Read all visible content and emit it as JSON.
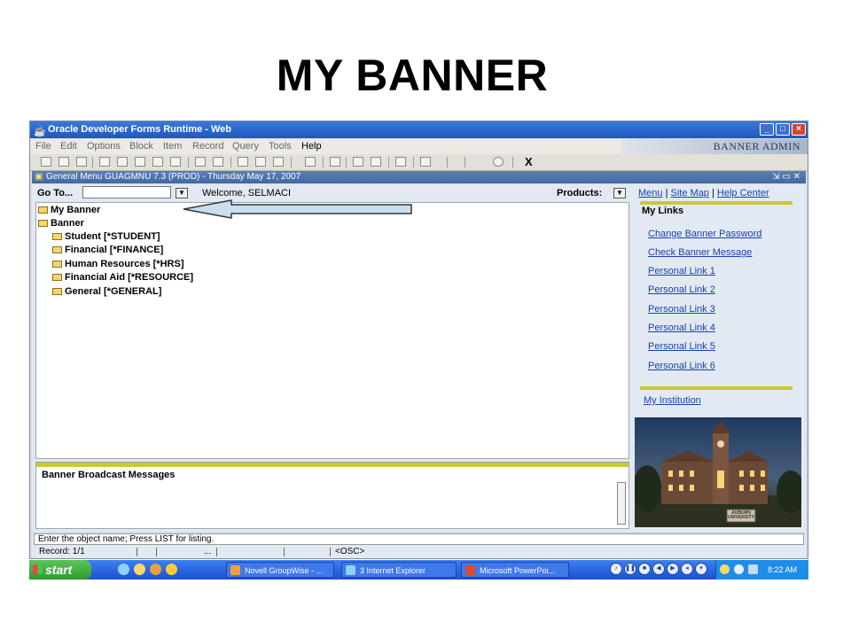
{
  "slide_title": "MY BANNER",
  "window": {
    "title": "Oracle Developer Forms Runtime - Web",
    "brand": "BANNER ADMIN",
    "menu": [
      "File",
      "Edit",
      "Options",
      "Block",
      "Item",
      "Record",
      "Query",
      "Tools",
      "Help"
    ],
    "toolbar_close": "X"
  },
  "inner_window": {
    "title": "General Menu  GUAGMNU  7.3  (PROD) - Thursday May 17, 2007",
    "controls": "⇲ ▭ ✕"
  },
  "goto": {
    "label": "Go To...",
    "value": "",
    "welcome": "Welcome, SELMACI",
    "products_label": "Products:"
  },
  "tree": [
    "My Banner",
    "Banner",
    "Student [*STUDENT]",
    "Financial [*FINANCE]",
    "Human Resources [*HRS]",
    "Financial Aid [*RESOURCE]",
    "General [*GENERAL]"
  ],
  "broadcast": {
    "title": "Banner Broadcast Messages"
  },
  "right_panel": {
    "top_links": [
      "Menu",
      "Site Map",
      "Help Center"
    ],
    "separator": "|",
    "my_links_title": "My Links",
    "links": [
      "Change Banner Password",
      "Check Banner Message",
      "Personal Link 1",
      "Personal Link 2",
      "Personal Link 3",
      "Personal Link 4",
      "Personal Link 5",
      "Personal Link 6"
    ],
    "institution_link": "My Institution",
    "photo_sign": "AUBURN UNIVERSITY"
  },
  "status": {
    "hint": "Enter the object name; Press LIST for listing.",
    "record": "Record: 1/1",
    "dots": "...",
    "osc": "<OSC>"
  },
  "taskbar": {
    "start": "start",
    "tasks": [
      "Novell GroupWise - ...",
      "3 Internet Explorer",
      "Microsoft PowerPoi..."
    ],
    "time": "8:22 AM"
  },
  "colors": {
    "title_blue": "#2056c0",
    "link_blue": "#1a3fb0",
    "accent_yellow": "#c8c83a",
    "taskbar_blue": "#1c50d0"
  }
}
